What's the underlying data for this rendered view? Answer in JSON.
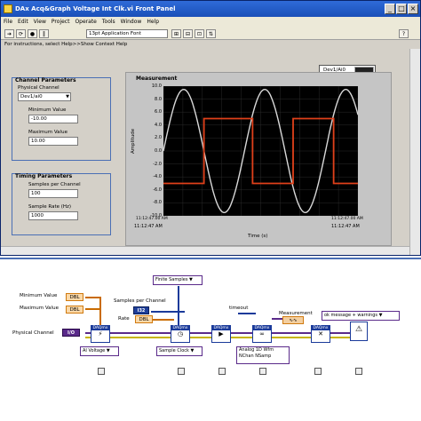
{
  "window": {
    "title": "DAQ Acq&Graph Voltage Int Clk.vi Front Panel",
    "title_short": "DAx Acq&Graph Voltage Int Clk.vi Front Panel",
    "min": "_",
    "max": "□",
    "close": "×"
  },
  "menu": [
    "File",
    "Edit",
    "View",
    "Project",
    "Operate",
    "Tools",
    "Window",
    "Help"
  ],
  "toolbar": {
    "font": "13pt Application Font"
  },
  "help_strip": "For instructions, select Help>>Show Context Help",
  "device_badge": "Dev1/Ai0",
  "channel_params": {
    "title": "Channel Parameters",
    "physical_channel_label": "Physical Channel",
    "physical_channel_value": "Dev1/ai0",
    "min_label": "Minimum Value",
    "min_value": "-10.00",
    "max_label": "Maximum Value",
    "max_value": "10.00"
  },
  "timing_params": {
    "title": "Timing Parameters",
    "spc_label": "Samples per Channel",
    "spc_value": "100",
    "rate_label": "Sample Rate (Hz)",
    "rate_value": "1000"
  },
  "graph": {
    "title": "Measurement",
    "ylabel": "Amplitude",
    "xlabel": "Time (s)",
    "y_ticks": [
      "10.0",
      "8.0",
      "6.0",
      "4.0",
      "2.0",
      "0.0",
      "-2.0",
      "-4.0",
      "-6.0",
      "-8.0",
      "-10.0"
    ],
    "x_ticks_lower": [
      "11:12:47 AM",
      "11:12:47 AM"
    ],
    "x_ticks_top": [
      "11:12:47.00 AM",
      "11:12:47.00 AM"
    ]
  },
  "chart_data": {
    "type": "line",
    "title": "Measurement",
    "xlabel": "Time (s)",
    "ylabel": "Amplitude",
    "ylim": [
      -10,
      10
    ],
    "grid": true,
    "series": [
      {
        "values": [
          0,
          5.9,
          9.5,
          9.5,
          5.9,
          0,
          -5.9,
          -9.5,
          -9.5,
          -5.9,
          0,
          5.9,
          9.5,
          9.5,
          5.9,
          0,
          -5.9,
          -9.5,
          -9.5,
          -5.9,
          0,
          5.9,
          9.5,
          9.5,
          5.9
        ]
      },
      {
        "values": [
          -5,
          -5,
          -5,
          -5,
          -5,
          5,
          5,
          5,
          5,
          5,
          5,
          -5,
          -5,
          -5,
          -5,
          -5,
          5,
          5,
          5,
          5,
          5,
          -5,
          -5,
          -5,
          -5
        ]
      }
    ],
    "colors": [
      "#d8d8d8",
      "#e0401a"
    ]
  },
  "diagram": {
    "min_label": "Minimum Value",
    "max_label": "Maximum Value",
    "dbl": "DBL",
    "spc_label": "Samples per Channel",
    "rate_label": "Rate",
    "i32": "I32",
    "phys_label": "Physical Channel",
    "phys_tag": "I/O",
    "finite": "Finite Samples",
    "timeout": "timeout",
    "measurement": "Measurement",
    "error_sel": "ok message + warnings",
    "ai_voltage": "AI Voltage",
    "sample_clock": "Sample Clock",
    "analog_read": "Analog 1D Wfm NChan NSamp",
    "vi_labels": [
      "DAQmx",
      "DAQmx",
      "DAQmx",
      "DAQmx",
      "DAQmx",
      "DAQmx"
    ]
  },
  "colors": {
    "titlebar": "#1a4fb8",
    "signal_sine": "#d8d8d8",
    "signal_square": "#e0401a",
    "plot_bg": "#000000"
  }
}
